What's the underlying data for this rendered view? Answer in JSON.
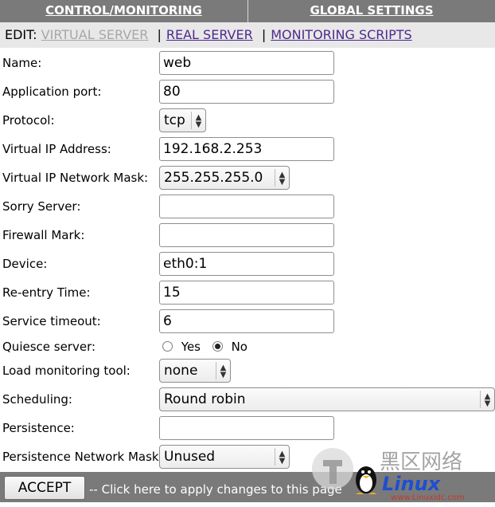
{
  "topnav": {
    "control_monitoring": "CONTROL/MONITORING",
    "global_settings": "GLOBAL SETTINGS"
  },
  "editbar": {
    "prefix": "EDIT:",
    "virtual_server": "VIRTUAL SERVER",
    "sep": "|",
    "real_server": "REAL SERVER",
    "monitoring_scripts": "MONITORING SCRIPTS"
  },
  "form": {
    "name": {
      "label": "Name:",
      "value": "web"
    },
    "application_port": {
      "label": "Application port:",
      "value": "80"
    },
    "protocol": {
      "label": "Protocol:",
      "value": "tcp"
    },
    "virtual_ip": {
      "label": "Virtual IP Address:",
      "value": "192.168.2.253"
    },
    "virtual_ip_mask": {
      "label": "Virtual IP Network Mask:",
      "value": "255.255.255.0"
    },
    "sorry_server": {
      "label": "Sorry Server:",
      "value": ""
    },
    "firewall_mark": {
      "label": "Firewall Mark:",
      "value": ""
    },
    "device": {
      "label": "Device:",
      "value": "eth0:1"
    },
    "reentry_time": {
      "label": "Re-entry Time:",
      "value": "15"
    },
    "service_timeout": {
      "label": "Service timeout:",
      "value": "6"
    },
    "quiesce_server": {
      "label": "Quiesce server:",
      "yes": "Yes",
      "no": "No",
      "selected": "No"
    },
    "load_monitoring_tool": {
      "label": "Load monitoring tool:",
      "value": "none"
    },
    "scheduling": {
      "label": "Scheduling:",
      "value": "Round robin"
    },
    "persistence": {
      "label": "Persistence:",
      "value": ""
    },
    "persistence_mask": {
      "label": "Persistence Network Mask:",
      "value": "Unused"
    }
  },
  "footer": {
    "accept": "ACCEPT",
    "hint": "-- Click here to apply changes to this page"
  },
  "watermark": {
    "cn_text": "黑区网络",
    "brand": "Linux",
    "site": "www.Linuxidc.com"
  },
  "colors": {
    "nav_bg": "#7a7a7a",
    "editbar_bg": "#e8e8e8",
    "link": "#4e2a8e",
    "disabled_link": "#a7a7a7"
  }
}
